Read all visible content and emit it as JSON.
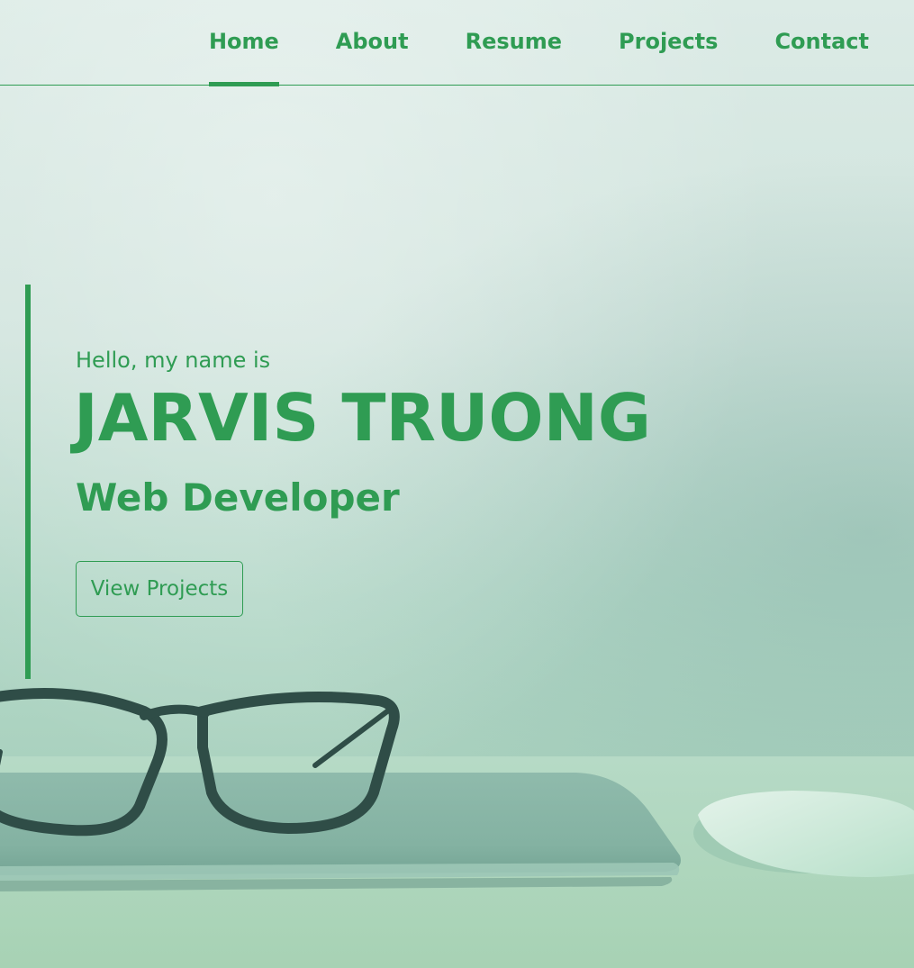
{
  "nav": {
    "items": [
      {
        "label": "Home",
        "active": true
      },
      {
        "label": "About",
        "active": false
      },
      {
        "label": "Resume",
        "active": false
      },
      {
        "label": "Projects",
        "active": false
      },
      {
        "label": "Contact",
        "active": false
      }
    ]
  },
  "hero": {
    "greeting": "Hello, my name is",
    "name": "JARVIS TRUONG",
    "role": "Web Developer",
    "cta_label": "View Projects"
  },
  "colors": {
    "accent": "#2f9c53"
  },
  "background_image": {
    "icon_names": [
      "laptop-image",
      "glasses-image",
      "mouse-image"
    ]
  }
}
